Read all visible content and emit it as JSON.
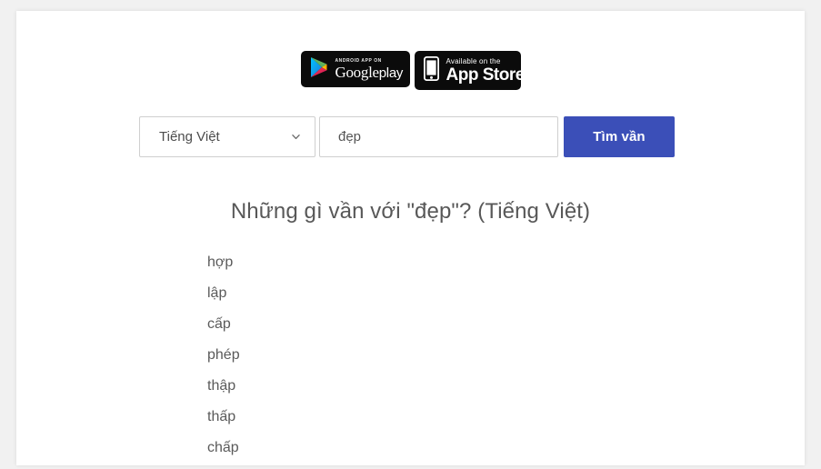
{
  "page": {
    "background_color": "#f1f1f1",
    "card_color": "#ffffff"
  },
  "badges": {
    "google_play": {
      "top_label": "ANDROID APP ON",
      "bottom_label_bold": "Google",
      "bottom_label_light": "play",
      "icon": "google-play-triangle-icon",
      "background_color": "#0b0b0b"
    },
    "app_store": {
      "top_label": "Available on the",
      "bottom_label": "App Store",
      "icon": "iphone-icon",
      "background_color": "#0b0b0b"
    }
  },
  "search": {
    "language_selected": "Tiếng Việt",
    "language_options": [
      "Tiếng Việt"
    ],
    "dropdown_icon": "chevron-down-icon",
    "word_value": "đẹp",
    "word_placeholder": "đẹp",
    "submit_label": "Tìm vần",
    "submit_color": "#3b4fb8"
  },
  "results": {
    "heading": "Những gì vần với \"đẹp\"? (Tiếng Việt)",
    "words": [
      "hợp",
      "lập",
      "cấp",
      "phép",
      "thập",
      "thấp",
      "chấp"
    ]
  }
}
